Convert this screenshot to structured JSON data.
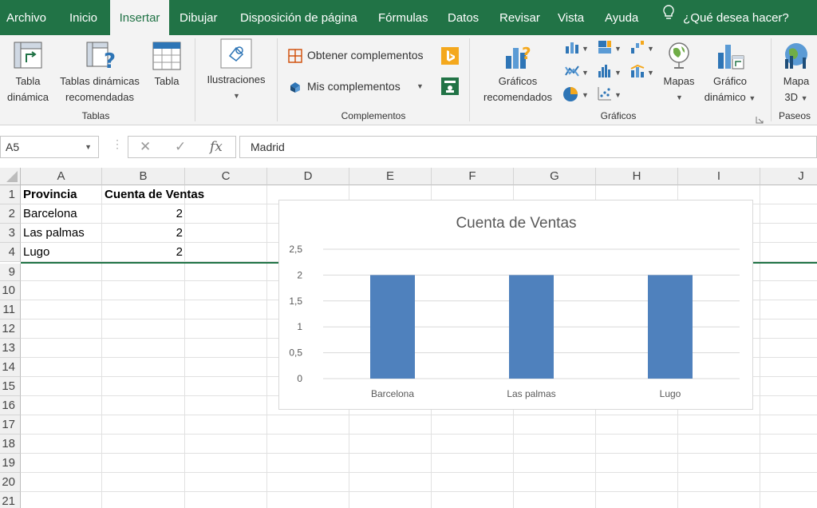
{
  "menu": {
    "tabs": [
      "Archivo",
      "Inicio",
      "Insertar",
      "Dibujar",
      "Disposición de página",
      "Fórmulas",
      "Datos",
      "Revisar",
      "Vista",
      "Ayuda"
    ],
    "active_tab": "Insertar",
    "tell_me": "¿Qué desea hacer?"
  },
  "ribbon": {
    "tablas": {
      "group_label": "Tablas",
      "tabla_dinamica": [
        "Tabla",
        "dinámica"
      ],
      "tablas_recomendadas": [
        "Tablas dinámicas",
        "recomendadas"
      ],
      "tabla": "Tabla"
    },
    "ilustraciones": {
      "label": "Ilustraciones"
    },
    "complementos": {
      "group_label": "Complementos",
      "obtener": "Obtener complementos",
      "mis": "Mis complementos"
    },
    "graficos": {
      "group_label": "Gráficos",
      "recomendados": [
        "Gráficos",
        "recomendados"
      ],
      "mapas": "Mapas",
      "dinamico": [
        "Gráfico",
        "dinámico"
      ]
    },
    "paseos": {
      "group_label": "Paseos",
      "mapa3d": [
        "Mapa",
        "3D"
      ]
    }
  },
  "formula_bar": {
    "name_box": "A5",
    "formula": "Madrid"
  },
  "sheet": {
    "columns": [
      "A",
      "B",
      "C",
      "D",
      "E",
      "F",
      "G",
      "H",
      "I",
      "J"
    ],
    "row_numbers": [
      "1",
      "2",
      "3",
      "4",
      "9",
      "10",
      "11",
      "12",
      "13",
      "14",
      "15",
      "16",
      "17",
      "18",
      "19",
      "20",
      "21"
    ],
    "cells": {
      "A1": "Provincia",
      "B1": "Cuenta de Ventas",
      "A2": "Barcelona",
      "B2": "2",
      "A3": "Las palmas",
      "B3": "2",
      "A4": "Lugo",
      "B4": "2"
    }
  },
  "chart_data": {
    "type": "bar",
    "title": "Cuenta de Ventas",
    "categories": [
      "Barcelona",
      "Las palmas",
      "Lugo"
    ],
    "values": [
      2,
      2,
      2
    ],
    "ylim": [
      0,
      2.5
    ],
    "yticks": [
      "0",
      "0,5",
      "1",
      "1,5",
      "2",
      "2,5"
    ],
    "ytick_values": [
      0,
      0.5,
      1,
      1.5,
      2,
      2.5
    ],
    "grid": true,
    "bar_color": "#4F81BD"
  },
  "colors": {
    "excel_green": "#217346",
    "bar": "#4F81BD"
  }
}
